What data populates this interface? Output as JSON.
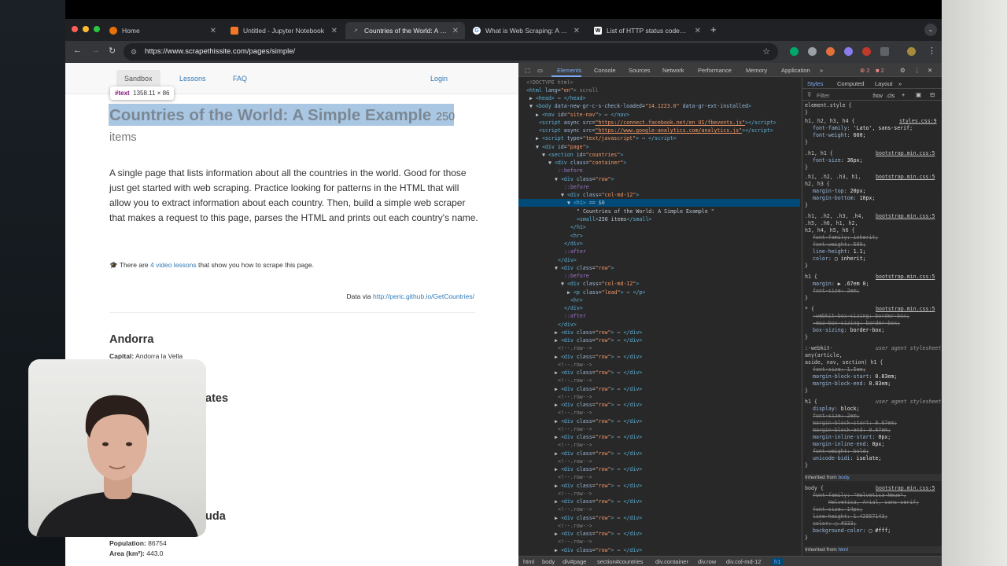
{
  "browser": {
    "tabs": [
      {
        "label": "Home",
        "icon_color": "#e8710a",
        "icon": "firefox-icon"
      },
      {
        "label": "Untitled - Jupyter Notebook",
        "icon_color": "#f37726",
        "icon": "jupyter-icon"
      },
      {
        "label": "Countries of the World: A Simpl",
        "icon_color": "#9aa0a6",
        "icon": "page-icon"
      },
      {
        "label": "What is Web Scraping: A Co",
        "icon_color": "#4285f4",
        "icon": "google-icon"
      },
      {
        "label": "List of HTTP status codes - W",
        "icon_color": "#ffffff",
        "icon": "wikipedia-icon"
      }
    ],
    "url": "https://www.scrapethissite.com/pages/simple/"
  },
  "site": {
    "nav": [
      "Sandbox",
      "Lessons",
      "FAQ",
      "Login"
    ],
    "tooltip_tag": "#text",
    "tooltip_size": "1358.11 × 86",
    "title": "Countries of the World: A Simple Example",
    "title_count": "250",
    "title_items": "items",
    "lead": "A single page that lists information about all the countries in the world. Good for those just get started with web scraping. Practice looking for patterns in the HTML that will allow you to extract information about each country. Then, build a simple web scraper that makes a request to this page, parses the HTML and prints out each country's name.",
    "videos_pre": "There are ",
    "videos_link": "4 video lessons",
    "videos_post": " that show you how to scrape this page.",
    "datavia_pre": "Data via ",
    "datavia_link": "http://peric.github.io/GetCountries/",
    "country1": "Andorra",
    "capital_label": "Capital:",
    "capital_value": "Andorra la Vella",
    "partial1": "ates",
    "partial2": "uda",
    "pop_label": "Population:",
    "pop_value": "86754",
    "area_label": "Area (km²):",
    "area_value": "443.0"
  },
  "devtools": {
    "tabs": [
      "Elements",
      "Console",
      "Sources",
      "Network",
      "Performance",
      "Memory",
      "Application"
    ],
    "errors": "2",
    "warnings": "2",
    "side_tabs": [
      "Styles",
      "Computed",
      "Layout"
    ],
    "filter_placeholder": "Filter",
    "hov": ":hov",
    ".cls": ".cls",
    "breadcrumbs": [
      "html",
      "body",
      "div#page",
      "section#countries",
      "div.container",
      "div.row",
      "div.col-md-12",
      "h1"
    ]
  }
}
